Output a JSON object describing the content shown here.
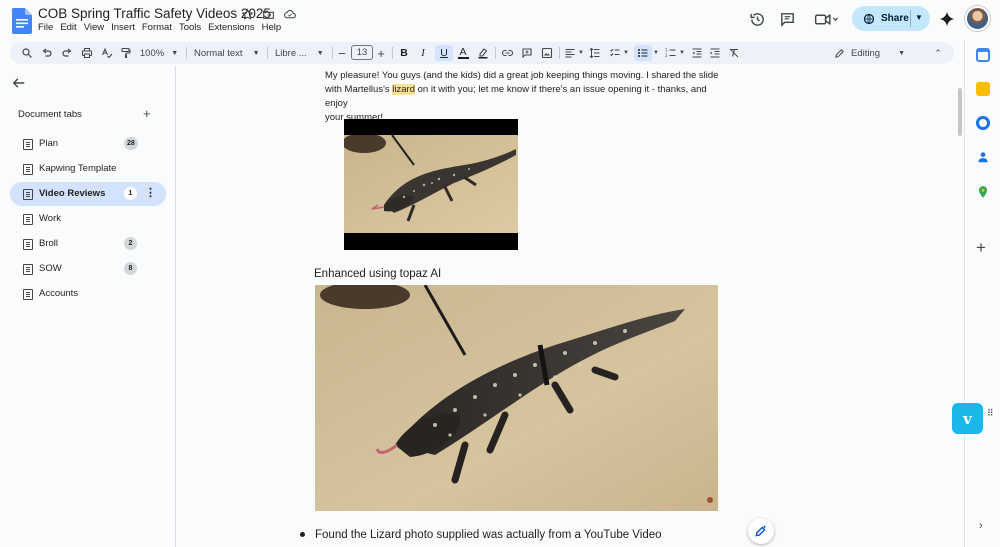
{
  "app": {
    "title": "COB Spring Traffic Safety Videos 2025",
    "menus": [
      "File",
      "Edit",
      "View",
      "Insert",
      "Format",
      "Tools",
      "Extensions",
      "Help"
    ],
    "share_label": "Share"
  },
  "toolbar": {
    "zoom": "100%",
    "style": "Normal text",
    "font": "Libre ...",
    "font_size": "13",
    "mode": "Editing"
  },
  "sidebar": {
    "header": "Document tabs",
    "tabs": [
      {
        "label": "Plan",
        "badge": "28"
      },
      {
        "label": "Kapwing Template",
        "badge": ""
      },
      {
        "label": "Video Reviews",
        "badge": "1"
      },
      {
        "label": "Work",
        "badge": ""
      },
      {
        "label": "Broll",
        "badge": "2"
      },
      {
        "label": "SOW",
        "badge": "8"
      },
      {
        "label": "Accounts",
        "badge": ""
      }
    ],
    "active_tab": "Video Reviews"
  },
  "document": {
    "para_line1": "My pleasure!  You guys (and the kids) did a great job keeping things moving.  I shared the slide",
    "para_line2_pre": "with Martellus's ",
    "para_line2_hl": "lizard",
    "para_line2_post": " on it with you; let me know if there's an issue opening it - thanks, and enjoy",
    "para_line3": "your summer!",
    "caption": "Enhanced using topaz AI",
    "bullet": "Found the Lizard photo supplied was actually from a YouTube Video"
  },
  "colors": {
    "accent": "#0b57d0",
    "share_bg": "#c2e7ff",
    "active_tab_bg": "#d3e3fd",
    "highlight": "#fde293",
    "vimeo": "#1ab7ea"
  }
}
